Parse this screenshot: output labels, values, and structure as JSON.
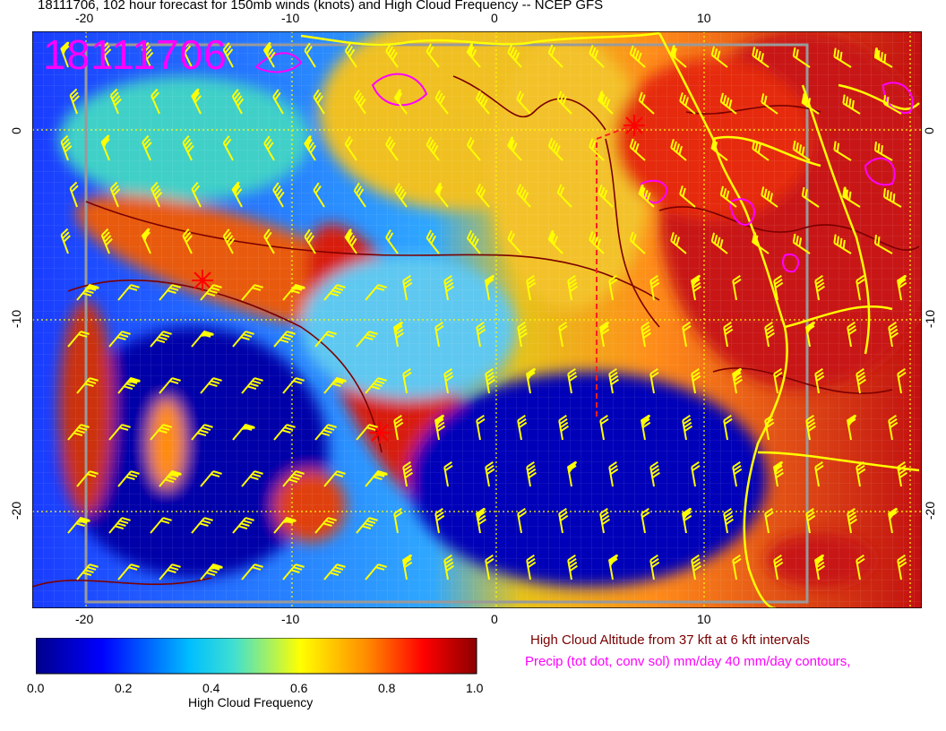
{
  "title": "18111706, 102 hour forecast for 150mb winds (knots) and High Cloud Frequency -- NCEP GFS",
  "stamp": "18111706",
  "axes": {
    "top_ticks": [
      "-20",
      "-10",
      "0",
      "10"
    ],
    "bottom_ticks": [
      "-20",
      "-10",
      "0",
      "10"
    ],
    "left_ticks": [
      "0",
      "-10",
      "-20"
    ],
    "right_ticks": [
      "0",
      "-10",
      "-20"
    ]
  },
  "colorbar": {
    "label": "High Cloud Frequency",
    "ticks": [
      "0.0",
      "0.2",
      "0.4",
      "0.6",
      "0.8",
      "1.0"
    ],
    "stops": [
      "#00008b",
      "#0000ff",
      "#00bfff",
      "#40e0d0",
      "#ffff00",
      "#ff8c00",
      "#ff0000",
      "#8b0000"
    ]
  },
  "notes": {
    "altitude": "High Cloud Altitude from 37 kft at 6 kft intervals",
    "precip": "Precip (tot dot, conv sol) mm/day 40 mm/day contours,"
  },
  "colors": {
    "coast": "#ffff00",
    "precip": "#ff00ff",
    "altitude": "#7a0000",
    "barbs": "#ffff00",
    "storm": "#ff0000"
  }
}
